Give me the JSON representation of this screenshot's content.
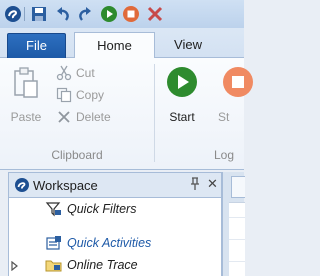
{
  "quick_access": {
    "items": [
      "app-icon",
      "save-icon",
      "undo-icon",
      "redo-icon",
      "start-icon",
      "stop-icon",
      "close-icon"
    ]
  },
  "ribbon": {
    "tabs": [
      {
        "label": "File"
      },
      {
        "label": "Home"
      },
      {
        "label": "View"
      }
    ],
    "clipboard": {
      "paste": "Paste",
      "cut": "Cut",
      "copy": "Copy",
      "delete": "Delete",
      "group_label": "Clipboard"
    },
    "logging": {
      "start": "Start",
      "stop": "St",
      "group_label": "Log"
    }
  },
  "workspace": {
    "title": "Workspace",
    "pin": "⌂",
    "close": "✕",
    "items": [
      {
        "label": "Quick Filters",
        "icon": "filter-icon"
      },
      {
        "label": "Quick Activities",
        "icon": "activities-icon"
      },
      {
        "label": "Online Trace",
        "icon": "trace-icon"
      }
    ]
  },
  "colors": {
    "file_tab": "#1d5aa8",
    "start_green": "#2e8b2e",
    "stop_orange": "#e06a3a",
    "selected_text": "#1e5aa8"
  }
}
